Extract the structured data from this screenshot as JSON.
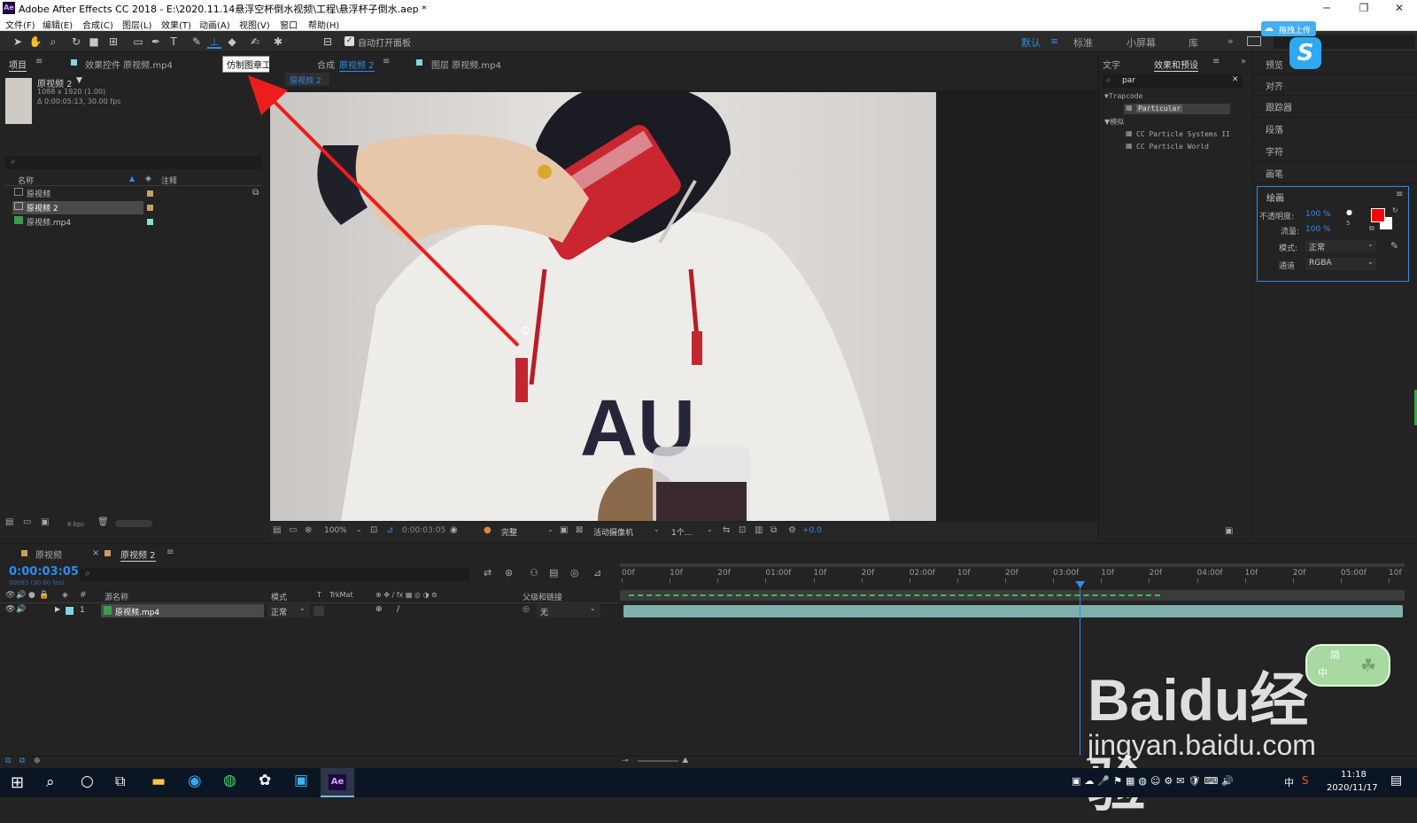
{
  "titlebar": {
    "app_icon": "Ae",
    "title": "Adobe After Effects CC 2018 - E:\\2020.11.14悬浮空杯倒水视频\\工程\\悬浮杯子倒水.aep *"
  },
  "menu": [
    "文件(F)",
    "编辑(E)",
    "合成(C)",
    "图层(L)",
    "效果(T)",
    "动画(A)",
    "视图(V)",
    "窗口",
    "帮助(H)"
  ],
  "toolbar": {
    "auto_open_label": "自动打开面板",
    "workspaces": [
      "默认",
      "标准",
      "小屏幕",
      "库"
    ],
    "search_placeholder": ""
  },
  "tooltip": "仿制图章工具 (Ctrl+B)",
  "project": {
    "tab": "项目",
    "tab2": "效果控件 原视频.mp4",
    "preview_name": "原视频 2",
    "preview_size": "1088 x 1920 (1.00)",
    "preview_duration": "Δ 0:00:05:13, 30.00 fps",
    "col_name": "名称",
    "col_comment": "注释",
    "items": [
      {
        "name": "原视频",
        "color": "#c9a15a"
      },
      {
        "name": "原视频 2",
        "color": "#c9a15a"
      },
      {
        "name": "原视频.mp4",
        "color": "#8be0d6"
      }
    ],
    "bpc": "8 bpc"
  },
  "comp": {
    "tab_prefix": "合成",
    "tab_name": "原视频 2",
    "layer_tab": "图层 原视频.mp4",
    "breadcrumb": "原视频 2",
    "zoom": "100%",
    "timecode": "0:00:03:05",
    "resolution": "完整",
    "camera": "活动摄像机",
    "views": "1个...",
    "exposure": "+0.0"
  },
  "right": {
    "tab_text": "文字",
    "tab_effects": "效果和预设",
    "search": "par",
    "group1": "Trapcode",
    "g1_item": "Particular",
    "group2": "模拟",
    "g2_items": [
      "CC Particle Systems II",
      "CC Particle World"
    ]
  },
  "sidepanels": [
    "预览",
    "对齐",
    "跟踪器",
    "段落",
    "字符",
    "画笔"
  ],
  "paint": {
    "title": "绘画",
    "opacity_label": "不透明度:",
    "opacity_value": "100 %",
    "flow_label": "流量:",
    "flow_value": "100 %",
    "mode_label": "模式:",
    "mode_value": "正常",
    "channel_label": "通道",
    "channel_value": "RGBA",
    "fg_color": "#ff0000",
    "bg_color": "#ffffff",
    "brush_size": "5"
  },
  "timeline": {
    "tab1": "原视频",
    "tab2": "原视频 2",
    "timecode": "0:00:03:05",
    "frames": "00095 (30.00 fps)",
    "cols": {
      "name": "源名称",
      "mode": "模式",
      "t": "T",
      "trkmat": "TrkMat",
      "parent": "父级和链接"
    },
    "layer": {
      "num": "1",
      "name": "原视频.mp4",
      "mode": "正常",
      "parent": "无"
    },
    "ruler": [
      "00f",
      "10f",
      "20f",
      "01:00f",
      "10f",
      "20f",
      "02:00f",
      "10f",
      "20f",
      "03:00f",
      "10f",
      "20f",
      "04:00f",
      "10f",
      "20f",
      "05:00f",
      "10f"
    ],
    "playhead_fraction": 0.586
  },
  "overlay": {
    "upload_btn": "拖拽上传",
    "ime": {
      "mode": "简",
      "lang": "中"
    },
    "watermark": "Baidu经验",
    "watermark_url": "jingyan.baidu.com"
  },
  "taskbar": {
    "time": "11:18",
    "date": "2020/11/17",
    "ime": "中"
  }
}
